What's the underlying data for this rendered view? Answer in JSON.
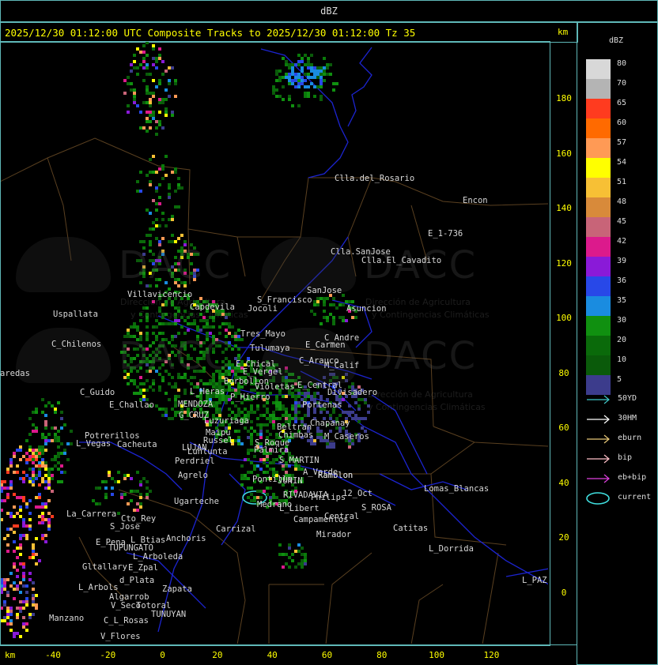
{
  "app_title": "dBZ",
  "scan_title": "2025/12/30 01:12:00 UTC Composite Tracks to 2025/12/30 01:12:00 Tz 35",
  "axis_unit": "km",
  "y_ticks": [
    "180",
    "160",
    "140",
    "120",
    "100",
    "80",
    "60",
    "40",
    "20",
    "0"
  ],
  "x_ticks": [
    "-40",
    "-20",
    "0",
    "20",
    "40",
    "60",
    "80",
    "100",
    "120"
  ],
  "legend": {
    "title": "dBZ",
    "levels": [
      {
        "label": "80",
        "color": "#d8d8d8"
      },
      {
        "label": "70",
        "color": "#b4b4b4"
      },
      {
        "label": "65",
        "color": "#ff3b1f"
      },
      {
        "label": "60",
        "color": "#ff6a00"
      },
      {
        "label": "57",
        "color": "#ff9a55"
      },
      {
        "label": "54",
        "color": "#ffff00"
      },
      {
        "label": "51",
        "color": "#f7c035"
      },
      {
        "label": "48",
        "color": "#d88a3a"
      },
      {
        "label": "45",
        "color": "#c86478"
      },
      {
        "label": "42",
        "color": "#dc1a8c"
      },
      {
        "label": "39",
        "color": "#8a1ad8"
      },
      {
        "label": "36",
        "color": "#2848e8"
      },
      {
        "label": "35",
        "color": "#1a8ce0"
      },
      {
        "label": "30",
        "color": "#109010"
      },
      {
        "label": "20",
        "color": "#0a6a0a"
      },
      {
        "label": "10",
        "color": "#0a5a0a"
      },
      {
        "label": "5",
        "color": "#3c3c8c"
      }
    ]
  },
  "tracks": [
    {
      "label": "50YD",
      "color": "#40c8c8",
      "icon": "arrow"
    },
    {
      "label": "30HM",
      "color": "#ffffff",
      "icon": "arrow"
    },
    {
      "label": "eburn",
      "color": "#e8c878",
      "icon": "arrow"
    },
    {
      "label": "bip",
      "color": "#ffc0c8",
      "icon": "arrow"
    },
    {
      "label": "eb+bip",
      "color": "#e040e0",
      "icon": "arrow"
    },
    {
      "label": "current",
      "color": "#40e0e0",
      "icon": "ellipse"
    }
  ],
  "watermark": {
    "brand": "DACC",
    "line1": "Dirección de Agricultura",
    "line2": "y Contingencias Climáticas"
  },
  "places": [
    "Clla.del_Rosario",
    "Encon",
    "E_1-736",
    "Ramblon",
    "Clla.SanJose",
    "Clla.El_Cavadito",
    "Villavicencio",
    "Capdevila",
    "S_Francisco",
    "SanJose",
    "Asuncion",
    "Uspallata",
    "Tres_Mayo",
    "C_Andre",
    "C_Chilenos",
    "Tulumaya",
    "E_Carmen",
    "C_Arauco",
    "M_Calif",
    "aredas",
    "E_Chical",
    "E_Vergel",
    "Borbollon",
    "Jocoli",
    "E_Central",
    "Divisadero",
    "C_Guido",
    "L_Heras",
    "Violetas",
    "P_Hierro",
    "Portenas",
    "E_Challao",
    "MENDOZA",
    "G_CRUZ",
    "Luzuriaga",
    "Beltran",
    "Chapanay",
    "Potrerillos",
    "Maipu",
    "Russel",
    "Chimbas",
    "M_Caseros",
    "L_Vegas",
    "Cacheuta",
    "LUJAN",
    "Lunlunta",
    "Palmira",
    "S_Roque",
    "Perdriel",
    "S_MARTIN",
    "Agrelo",
    "A_Verde",
    "Ramblon",
    "Pontilla",
    "JUNIN",
    "Lomas_Blancas",
    "Ugarteche",
    "RIVADAVIA",
    "12_Oct",
    "S_ROSA",
    "La_Carrera",
    "Cto_Rey",
    "Medrano",
    "Philips",
    "S_Jose",
    "Carrizal",
    "L_Libert",
    "Campamentos",
    "Central",
    "Catitas",
    "E_Pena",
    "TUPUNGATO",
    "L_Btias",
    "Anchoris",
    "Mirador",
    "L_Dorrida",
    "L_Arboleda",
    "Gltallary",
    "E_Zpal",
    "d_Plata",
    "L_PAZ",
    "L_Arbols",
    "Algarrob",
    "Zapata",
    "V_Seco",
    "Totoral",
    "TUNUYAN",
    "Manzano",
    "C_L_Rosas",
    "V_Flores"
  ]
}
